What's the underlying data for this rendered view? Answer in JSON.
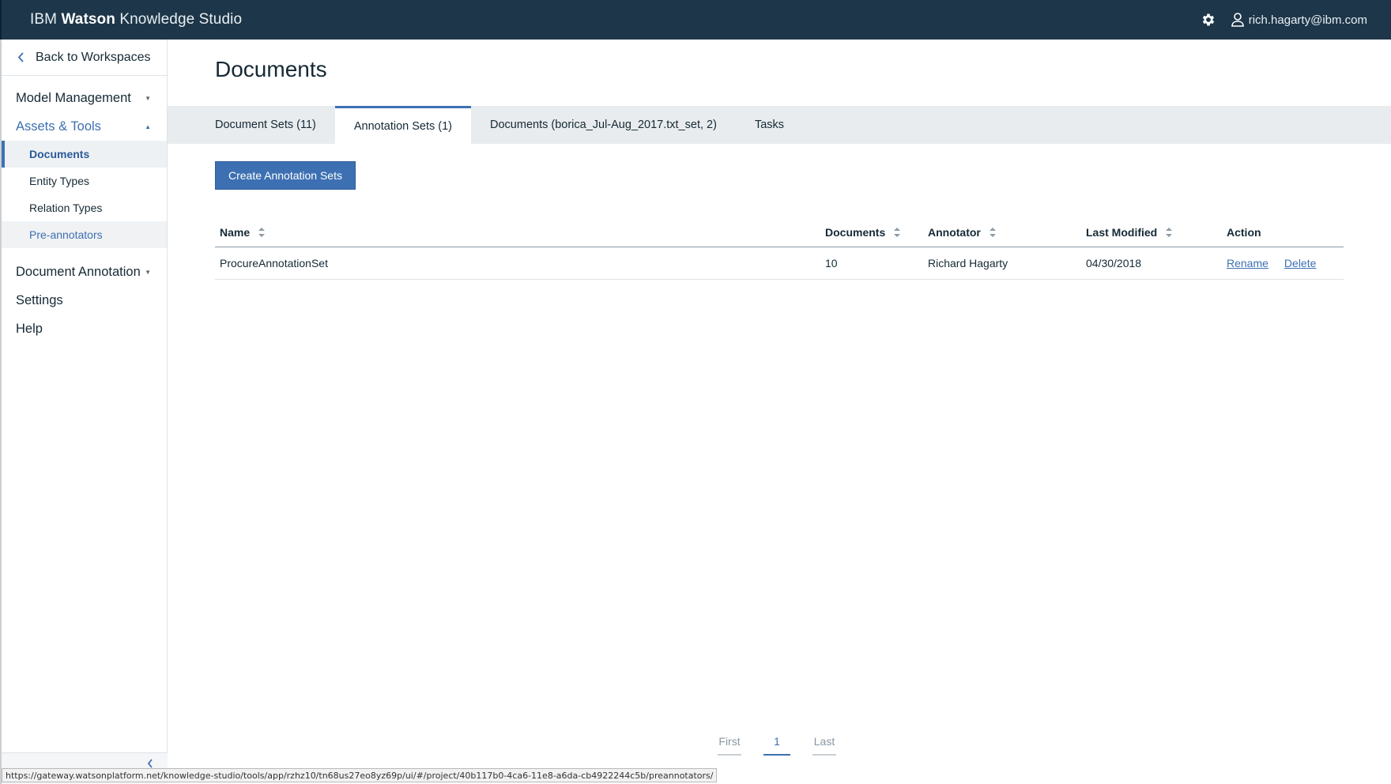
{
  "header": {
    "brand_prefix": "IBM ",
    "brand_bold": "Watson",
    "brand_suffix": " Knowledge Studio",
    "user_email": "rich.hagarty@ibm.com"
  },
  "sidebar": {
    "back_label": "Back to Workspaces",
    "groups": [
      {
        "label": "Model Management"
      },
      {
        "label": "Assets & Tools"
      },
      {
        "label": "Document Annotation"
      },
      {
        "label": "Settings"
      },
      {
        "label": "Help"
      }
    ],
    "sub_items": [
      {
        "label": "Documents"
      },
      {
        "label": "Entity Types"
      },
      {
        "label": "Relation Types"
      },
      {
        "label": "Pre-annotators"
      }
    ]
  },
  "main": {
    "title": "Documents",
    "tabs": [
      {
        "label": "Document Sets (11)"
      },
      {
        "label": "Annotation Sets (1)"
      },
      {
        "label": "Documents (borica_Jul-Aug_2017.txt_set, 2)"
      },
      {
        "label": "Tasks"
      }
    ],
    "create_button": "Create Annotation Sets",
    "table": {
      "columns": [
        "Name",
        "Documents",
        "Annotator",
        "Last Modified",
        "Action"
      ],
      "rows": [
        {
          "name": "ProcureAnnotationSet",
          "documents": "10",
          "annotator": "Richard Hagarty",
          "last_modified": "04/30/2018",
          "actions": [
            "Rename",
            "Delete"
          ]
        }
      ]
    },
    "pagination": {
      "first": "First",
      "current": "1",
      "last": "Last"
    }
  },
  "status_url": "https://gateway.watsonplatform.net/knowledge-studio/tools/app/rzhz10/tn68us27eo8yz69p/ui/#/project/40b117b0-4ca6-11e8-a6da-cb4922244c5b/preannotators/",
  "colors": {
    "header_bg": "#1d3649",
    "accent": "#3d70b2",
    "tab_bar_bg": "#e9ecee"
  }
}
